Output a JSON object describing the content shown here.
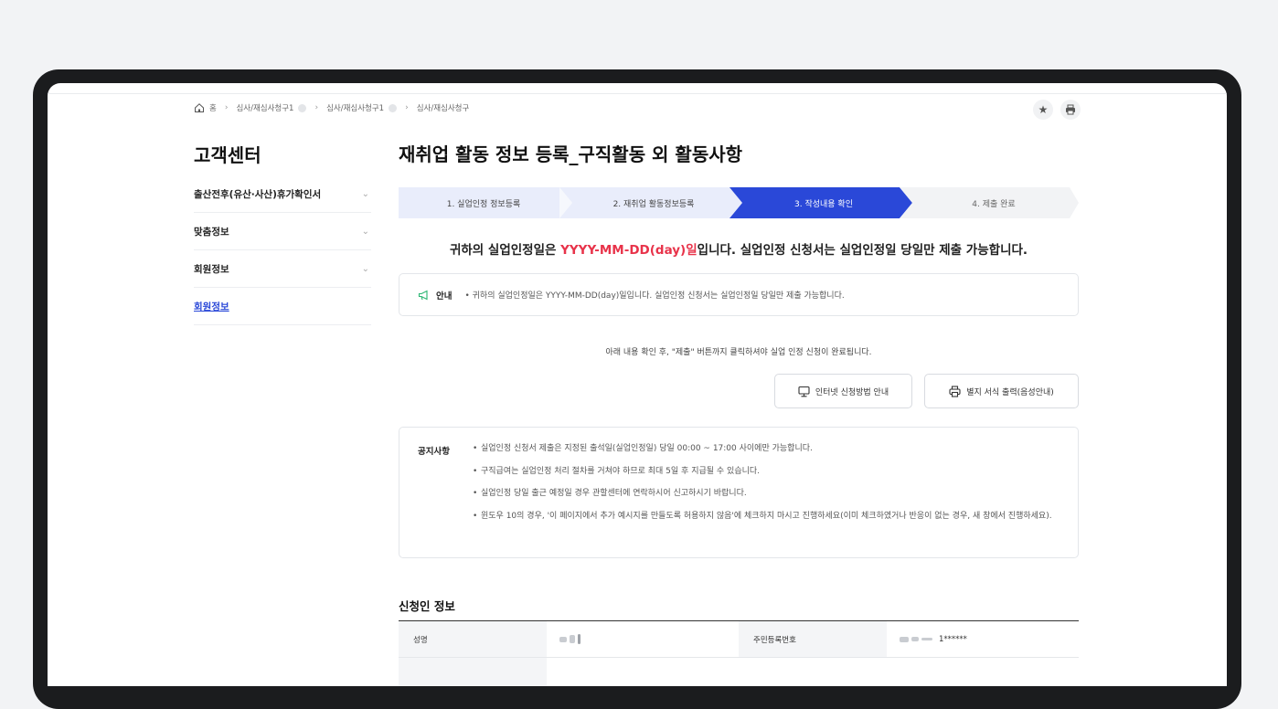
{
  "breadcrumb": {
    "home": "홈",
    "items": [
      "심사/재심사청구1",
      "심사/재심사청구1",
      "심사/재심사청구"
    ]
  },
  "sidebar": {
    "title": "고객센터",
    "items": [
      {
        "label": "출산전후(유산·사산)휴가확인서",
        "expandable": true
      },
      {
        "label": "맞춤정보",
        "expandable": true
      },
      {
        "label": "회원정보",
        "expandable": true
      },
      {
        "label": "회원정보",
        "expandable": false,
        "active": true
      }
    ]
  },
  "main": {
    "title": "재취업 활동 정보 등록_구직활동 외 활동사항",
    "steps": [
      {
        "label": "1. 실업인정 정보등록",
        "state": "done"
      },
      {
        "label": "2. 재취업 활동정보등록",
        "state": "done"
      },
      {
        "label": "3. 작성내용 확인",
        "state": "current"
      },
      {
        "label": "4. 제출 완료",
        "state": "todo"
      }
    ],
    "date_line": {
      "prefix": "귀하의 실업인정일은 ",
      "highlight": "YYYY-MM-DD(day)일",
      "suffix": "입니다. 실업인정 신청서는 실업인정일 당일만 제출 가능합니다."
    },
    "notice_box": {
      "label": "안내",
      "text": "• 귀하의 실업인정일은 YYYY-MM-DD(day)일입니다. 실업인정 신청서는 실업인정일 당일만 제출 가능합니다."
    },
    "guide_text": "아래 내용 확인 후, \"제출\" 버튼까지 클릭하셔야 실업 인정 신청이 완료됩니다.",
    "buttons": {
      "internet_guide": "인터넷 신청방법 안내",
      "print_form": "별지 서식 출력(음성안내)"
    },
    "notices": {
      "label": "공지사항",
      "items": [
        "실업인정 신청서 제출은 지정된 출석일(실업인정일) 당일 00:00 ~ 17:00 사이에만 가능합니다.",
        "구직급여는 실업인정 처리 절차를 거쳐야 하므로 최대 5일 후 지급될 수 있습니다.",
        "실업인정 당일 출근 예정일 경우 관할센터에 연락하시어 신고하시기 바랍니다.",
        "윈도우 10의 경우, '이 페이지에서 추가 예시지를 만들도록 허용하지 않음'에 체크하지 마시고 진행하세요(이미 체크하였거나 반응이 없는 경우, 새 창에서 진행하세요)."
      ]
    },
    "applicant": {
      "section_title": "신청인 정보",
      "name_label": "성명",
      "rrn_label": "주민등록번호",
      "rrn_value": "1******"
    }
  },
  "colors": {
    "accent": "#2a48d8",
    "step_done": "#e9edfb",
    "step_todo": "#f2f3f5",
    "highlight_red": "#e8334a"
  }
}
